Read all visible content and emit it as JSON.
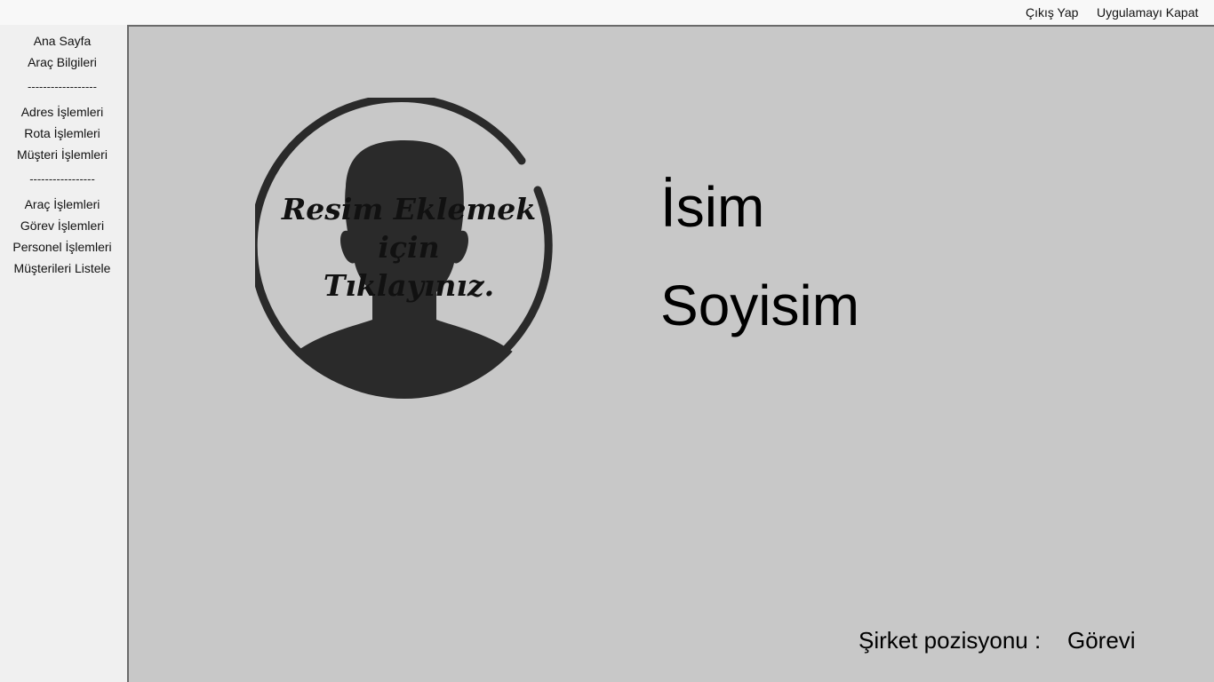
{
  "topbar": {
    "logout_label": "Çıkış Yap",
    "close_app_label": "Uygulamayı Kapat"
  },
  "sidebar": {
    "items": [
      {
        "label": "Ana Sayfa"
      },
      {
        "label": "Araç Bilgileri"
      },
      {
        "label": "------------------"
      },
      {
        "label": "Adres İşlemleri"
      },
      {
        "label": "Rota İşlemleri"
      },
      {
        "label": "Müşteri İşlemleri"
      },
      {
        "label": "-----------------"
      },
      {
        "label": "Araç İşlemleri"
      },
      {
        "label": "Görev İşlemleri"
      },
      {
        "label": "Personel İşlemleri"
      },
      {
        "label": "Müşterileri Listele"
      }
    ]
  },
  "profile": {
    "photo_caption_line1": "Resim Eklemek",
    "photo_caption_line2": "için",
    "photo_caption_line3": "Tıklayınız.",
    "first_name": "İsim",
    "last_name": "Soyisim",
    "position_label": "Şirket pozisyonu :",
    "position_value": "Görevi"
  },
  "colors": {
    "main_bg": "#c8c8c8",
    "sidebar_bg": "#f0f0f0",
    "avatar_fill": "#2a2a2a"
  },
  "icons": {
    "avatar": "user-silhouette-icon"
  }
}
